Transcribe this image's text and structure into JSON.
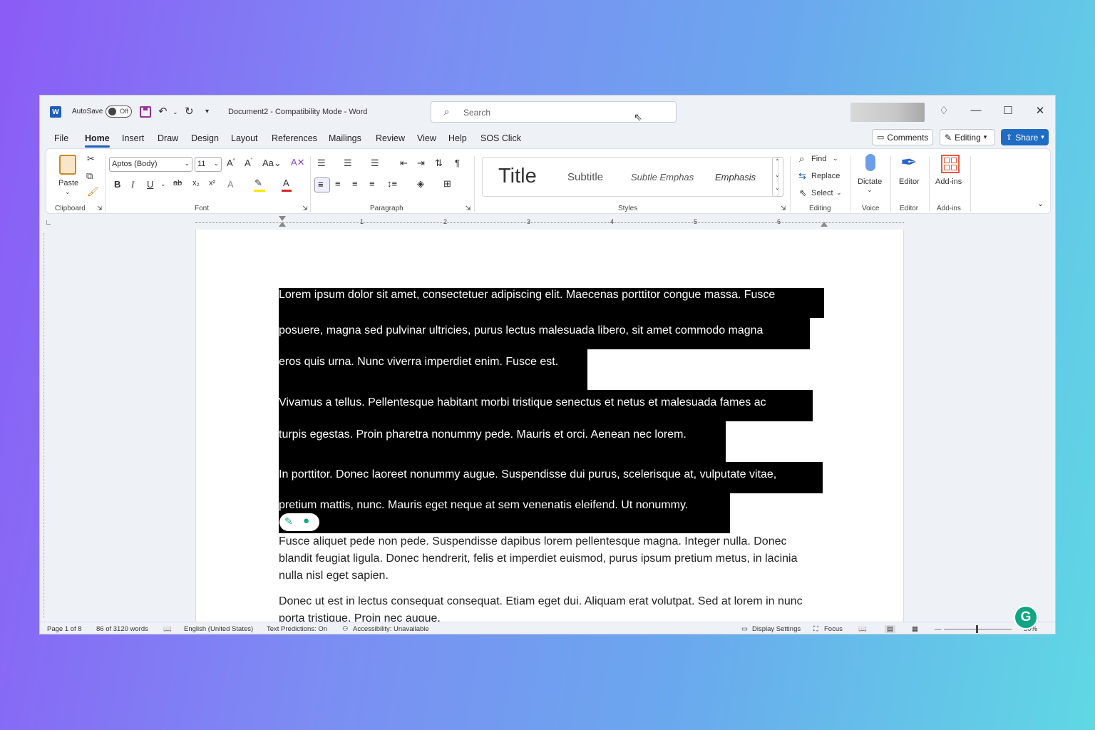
{
  "titlebar": {
    "logo_letter": "W",
    "autosave_label": "AutoSave",
    "autosave_state": "Off",
    "document_title": "Document2  -  Compatibility Mode  -  Word",
    "search_placeholder": "Search"
  },
  "menu": {
    "items": [
      "File",
      "Home",
      "Insert",
      "Draw",
      "Design",
      "Layout",
      "References",
      "Mailings",
      "Review",
      "View",
      "Help",
      "SOS Click"
    ],
    "active": "Home",
    "comments_label": "Comments",
    "editing_label": "Editing",
    "share_label": "Share"
  },
  "ribbon": {
    "clipboard": {
      "paste_label": "Paste",
      "group_label": "Clipboard"
    },
    "font": {
      "font_name": "Aptos (Body)",
      "font_size": "11",
      "group_label": "Font"
    },
    "paragraph": {
      "group_label": "Paragraph"
    },
    "styles": {
      "items": [
        "Title",
        "Subtitle",
        "Subtle Emphas",
        "Emphasis"
      ],
      "group_label": "Styles"
    },
    "editing": {
      "find_label": "Find",
      "replace_label": "Replace",
      "select_label": "Select",
      "group_label": "Editing"
    },
    "voice": {
      "dictate_label": "Dictate",
      "group_label": "Voice"
    },
    "editor": {
      "editor_label": "Editor",
      "group_label": "Editor"
    },
    "addins": {
      "addins_label": "Add-ins",
      "group_label": "Add-ins"
    }
  },
  "ruler": {
    "numbers": [
      "1",
      "2",
      "3",
      "4",
      "5",
      "6"
    ]
  },
  "document": {
    "selected_lines": [
      "Lorem ipsum dolor sit amet, consectetuer adipiscing elit. Maecenas porttitor congue massa. Fusce",
      "posuere, magna sed pulvinar ultricies, purus lectus malesuada libero, sit amet commodo magna",
      "eros quis urna. Nunc viverra imperdiet enim. Fusce est.",
      "Vivamus a tellus. Pellentesque habitant morbi tristique senectus et netus et malesuada fames ac",
      "turpis egestas. Proin pharetra nonummy pede. Mauris et orci. Aenean nec lorem.",
      "In porttitor. Donec laoreet nonummy augue. Suspendisse dui purus, scelerisque at, vulputate vitae,",
      "pretium mattis, nunc. Mauris eget neque at sem venenatis eleifend. Ut nonummy."
    ],
    "paragraph_4": "Fusce aliquet pede non pede. Suspendisse dapibus lorem pellentesque magna. Integer nulla. Donec blandit feugiat ligula. Donec hendrerit, felis et imperdiet euismod, purus ipsum pretium metus, in lacinia nulla nisl eget sapien.",
    "paragraph_5": "Donec ut est in lectus consequat consequat. Etiam eget dui. Aliquam erat volutpat. Sed at lorem in nunc porta tristique. Proin nec augue."
  },
  "statusbar": {
    "page": "Page 1 of 8",
    "words": "86 of 3120 words",
    "language": "English (United States)",
    "text_predictions": "Text Predictions: On",
    "accessibility": "Accessibility: Unavailable",
    "display_settings": "Display Settings",
    "focus": "Focus",
    "zoom": "50%"
  },
  "colors": {
    "accent": "#1d5fb8",
    "share": "#1f6cc5",
    "selection": "#000000",
    "grammarly": "#11a683"
  }
}
